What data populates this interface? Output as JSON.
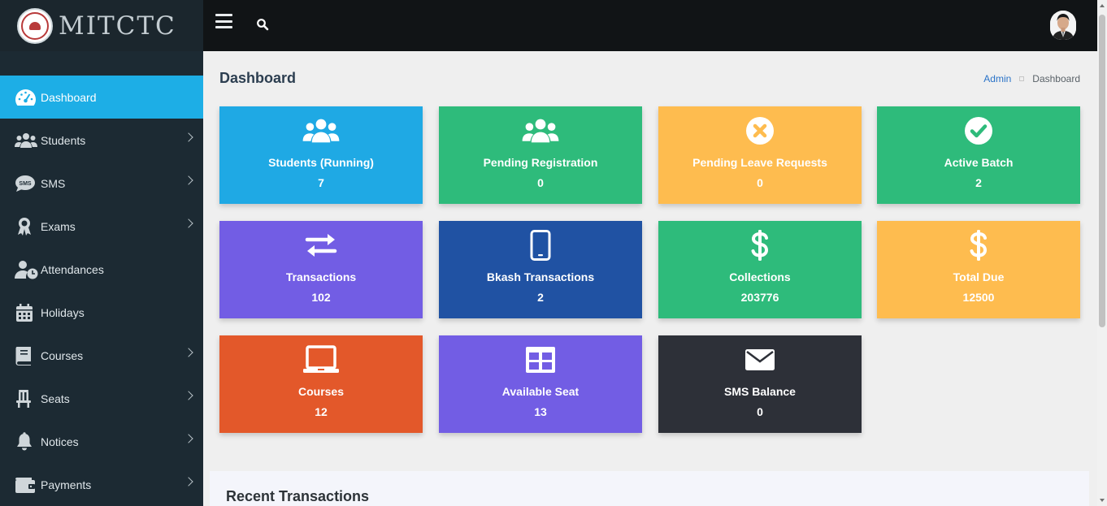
{
  "brand": {
    "name": "MITCTC"
  },
  "sidebar": {
    "items": [
      {
        "label": "Dashboard",
        "icon": "tachometer-icon",
        "active": true
      },
      {
        "label": "Students",
        "icon": "users-icon"
      },
      {
        "label": "SMS",
        "icon": "sms-icon"
      },
      {
        "label": "Exams",
        "icon": "award-icon"
      },
      {
        "label": "Attendances",
        "icon": "user-clock-icon"
      },
      {
        "label": "Holidays",
        "icon": "calendar-icon"
      },
      {
        "label": "Courses",
        "icon": "book-icon"
      },
      {
        "label": "Seats",
        "icon": "chair-icon"
      },
      {
        "label": "Notices",
        "icon": "bell-icon"
      },
      {
        "label": "Payments",
        "icon": "wallet-icon"
      }
    ]
  },
  "topbar": {
    "menu_icon": "bars-icon",
    "search_icon": "search-icon"
  },
  "page": {
    "title": "Dashboard",
    "breadcrumb": {
      "link": "Admin",
      "current": "Dashboard"
    }
  },
  "cards": [
    {
      "label": "Students (Running)",
      "value": "7",
      "color": "#1fa9e4",
      "icon": "users-icon"
    },
    {
      "label": "Pending Registration",
      "value": "0",
      "color": "#2ebb7b",
      "icon": "users-icon"
    },
    {
      "label": "Pending Leave Requests",
      "value": "0",
      "color": "#febc4f",
      "icon": "times-circle-icon"
    },
    {
      "label": "Active Batch",
      "value": "2",
      "color": "#2ebb7b",
      "icon": "check-circle-icon"
    },
    {
      "label": "Transactions",
      "value": "102",
      "color": "#725de4",
      "icon": "exchange-icon"
    },
    {
      "label": "Bkash Transactions",
      "value": "2",
      "color": "#2052a3",
      "icon": "mobile-icon"
    },
    {
      "label": "Collections",
      "value": "203776",
      "color": "#2ebb7b",
      "icon": "dollar-icon"
    },
    {
      "label": "Total Due",
      "value": "12500",
      "color": "#febc4f",
      "icon": "dollar-icon"
    },
    {
      "label": "Courses",
      "value": "12",
      "color": "#e3582a",
      "icon": "laptop-icon"
    },
    {
      "label": "Available Seat",
      "value": "13",
      "color": "#725de4",
      "icon": "grid-icon"
    },
    {
      "label": "SMS Balance",
      "value": "0",
      "color": "#2d3038",
      "icon": "envelope-icon"
    }
  ],
  "recent": {
    "title": "Recent Transactions"
  }
}
